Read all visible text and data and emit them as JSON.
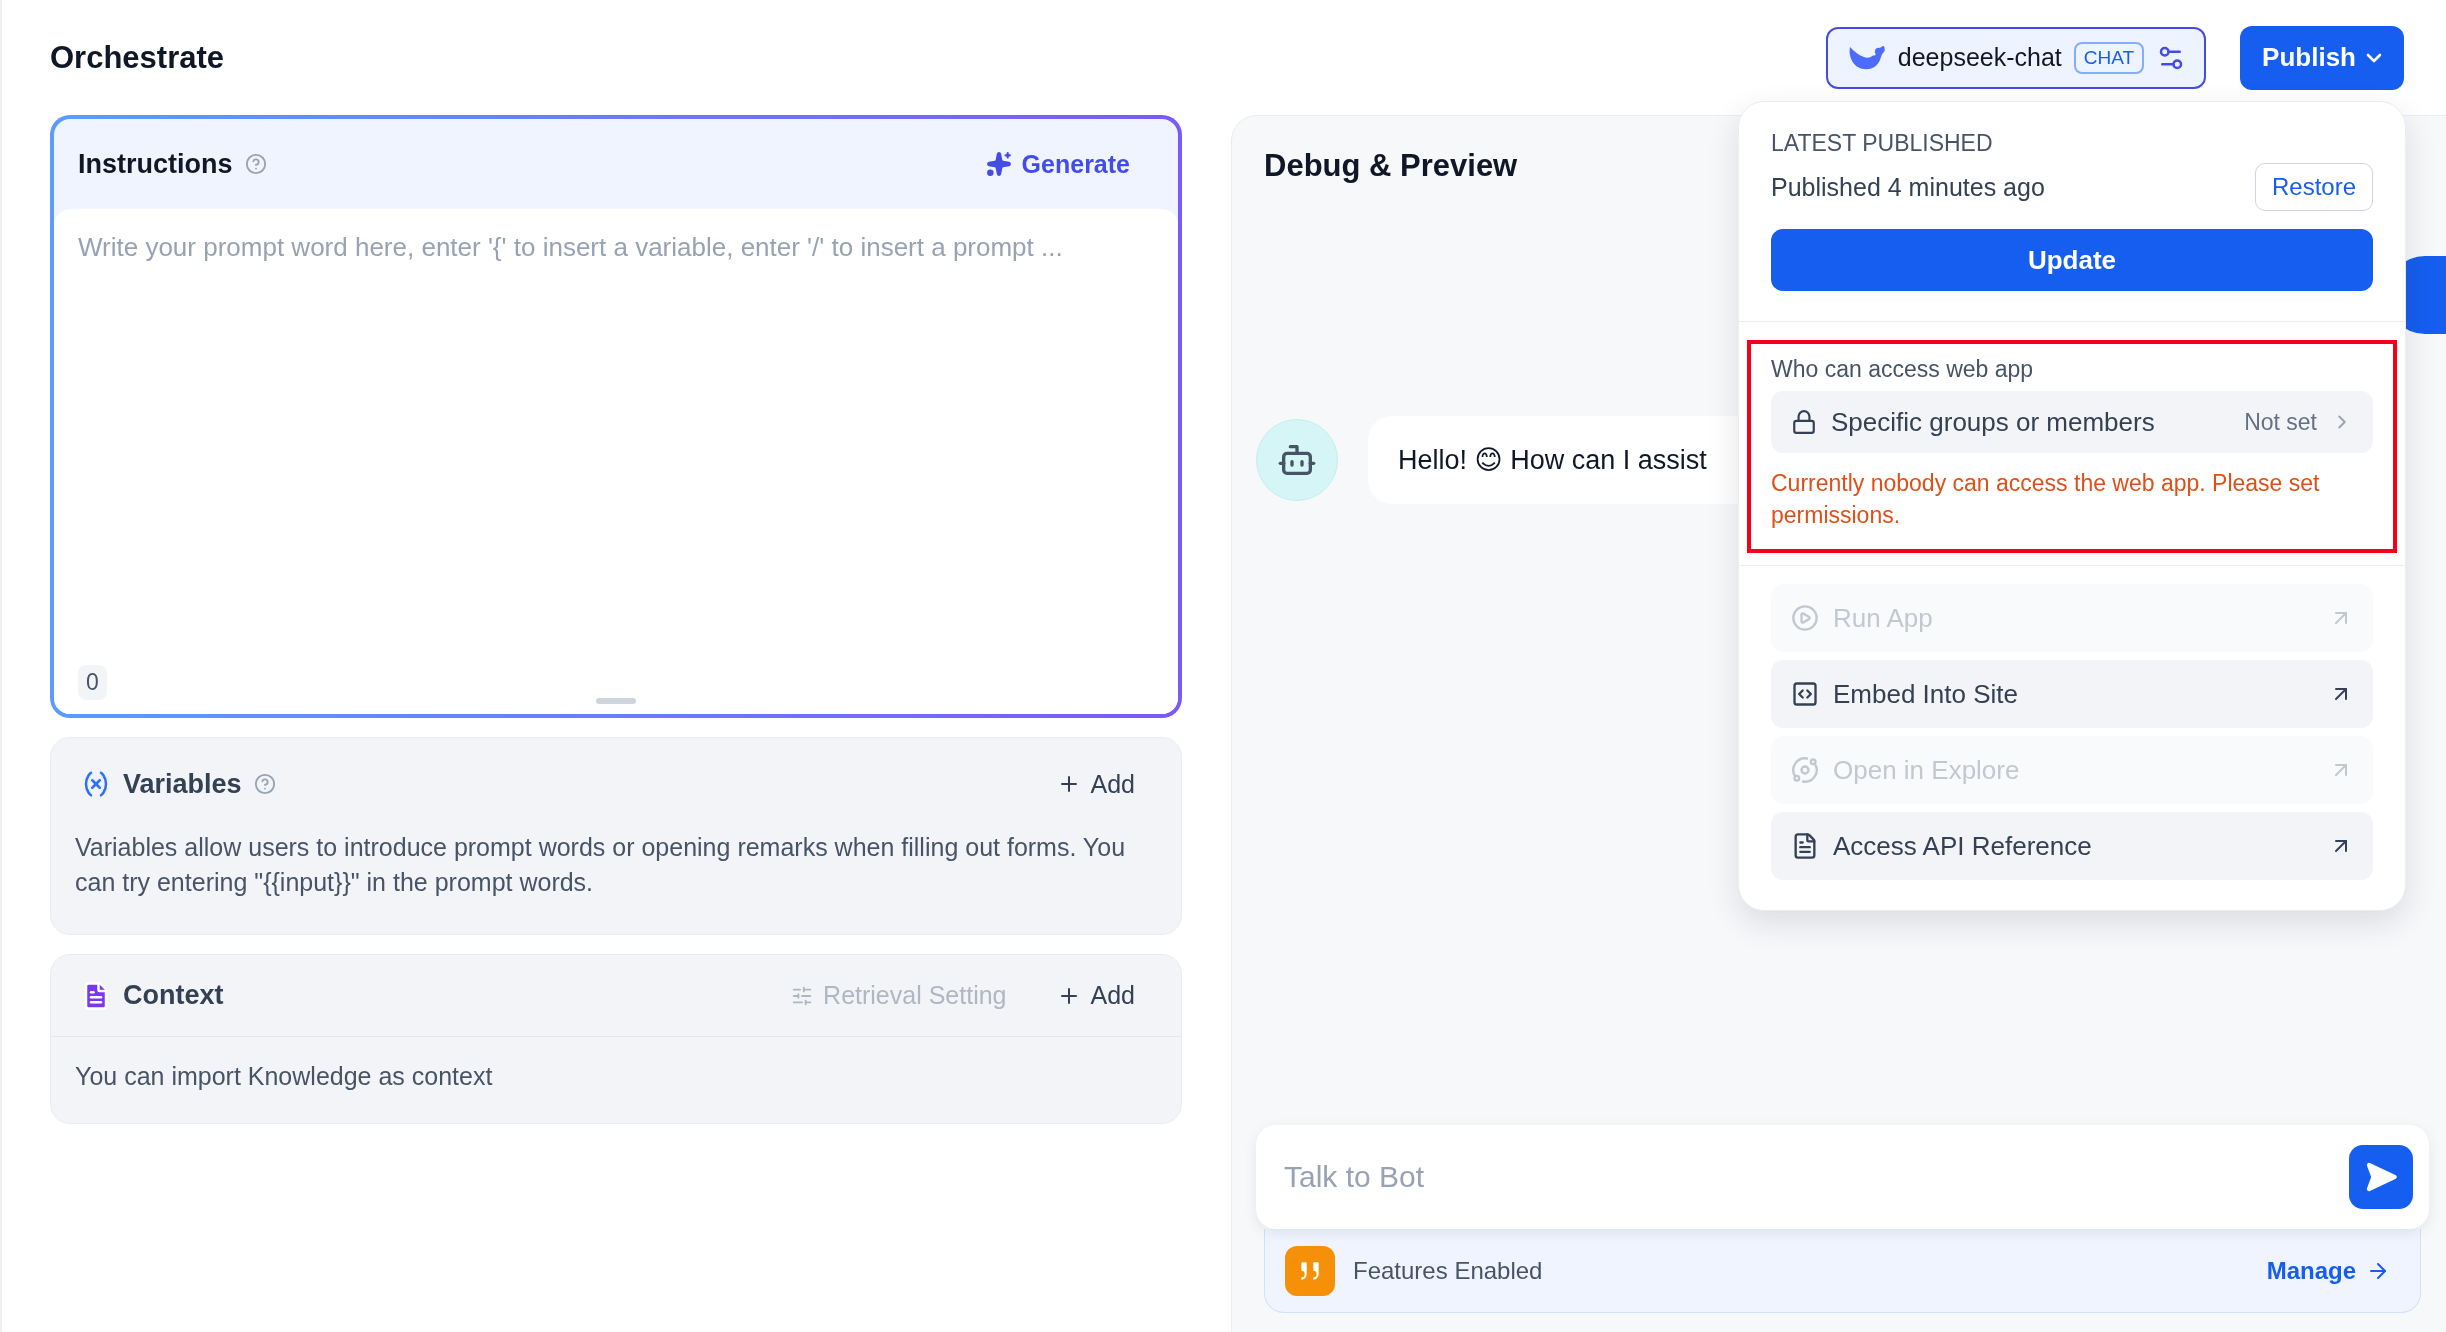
{
  "header": {
    "title": "Orchestrate",
    "model": {
      "name": "deepseek-chat",
      "badge": "CHAT"
    },
    "publish_button": "Publish"
  },
  "instructions": {
    "title": "Instructions",
    "generate": "Generate",
    "placeholder": "Write your prompt word here, enter '{' to insert a variable, enter '/' to insert a prompt ...",
    "count": "0"
  },
  "variables": {
    "title": "Variables",
    "add": "Add",
    "description": "Variables allow users to introduce prompt words or opening remarks when filling out forms. You can try entering \"{{input}}\" in the prompt words."
  },
  "context": {
    "title": "Context",
    "retrieval_setting": {
      "label": "Retrieval Setting",
      "disabled": true
    },
    "add": "Add",
    "description": "You can import Knowledge as context"
  },
  "debug": {
    "title": "Debug & Preview",
    "message": "Hello! 😊 How can I assist",
    "input_placeholder": "Talk to Bot",
    "features": "Features Enabled",
    "manage": "Manage"
  },
  "publish_menu": {
    "latest_label": "LATEST PUBLISHED",
    "published_time": "Published 4 minutes ago",
    "restore": "Restore",
    "update": "Update",
    "access": {
      "label": "Who can access web app",
      "option": "Specific groups or members",
      "value": "Not set",
      "warning": "Currently nobody can access the web app. Please set permissions.",
      "highlighted": true
    },
    "actions": [
      {
        "kind": "run",
        "label": "Run App",
        "disabled": true
      },
      {
        "kind": "embed",
        "label": "Embed Into Site",
        "disabled": false
      },
      {
        "kind": "explore",
        "label": "Open in Explore",
        "disabled": true
      },
      {
        "kind": "api",
        "label": "Access API Reference",
        "disabled": false
      }
    ]
  }
}
